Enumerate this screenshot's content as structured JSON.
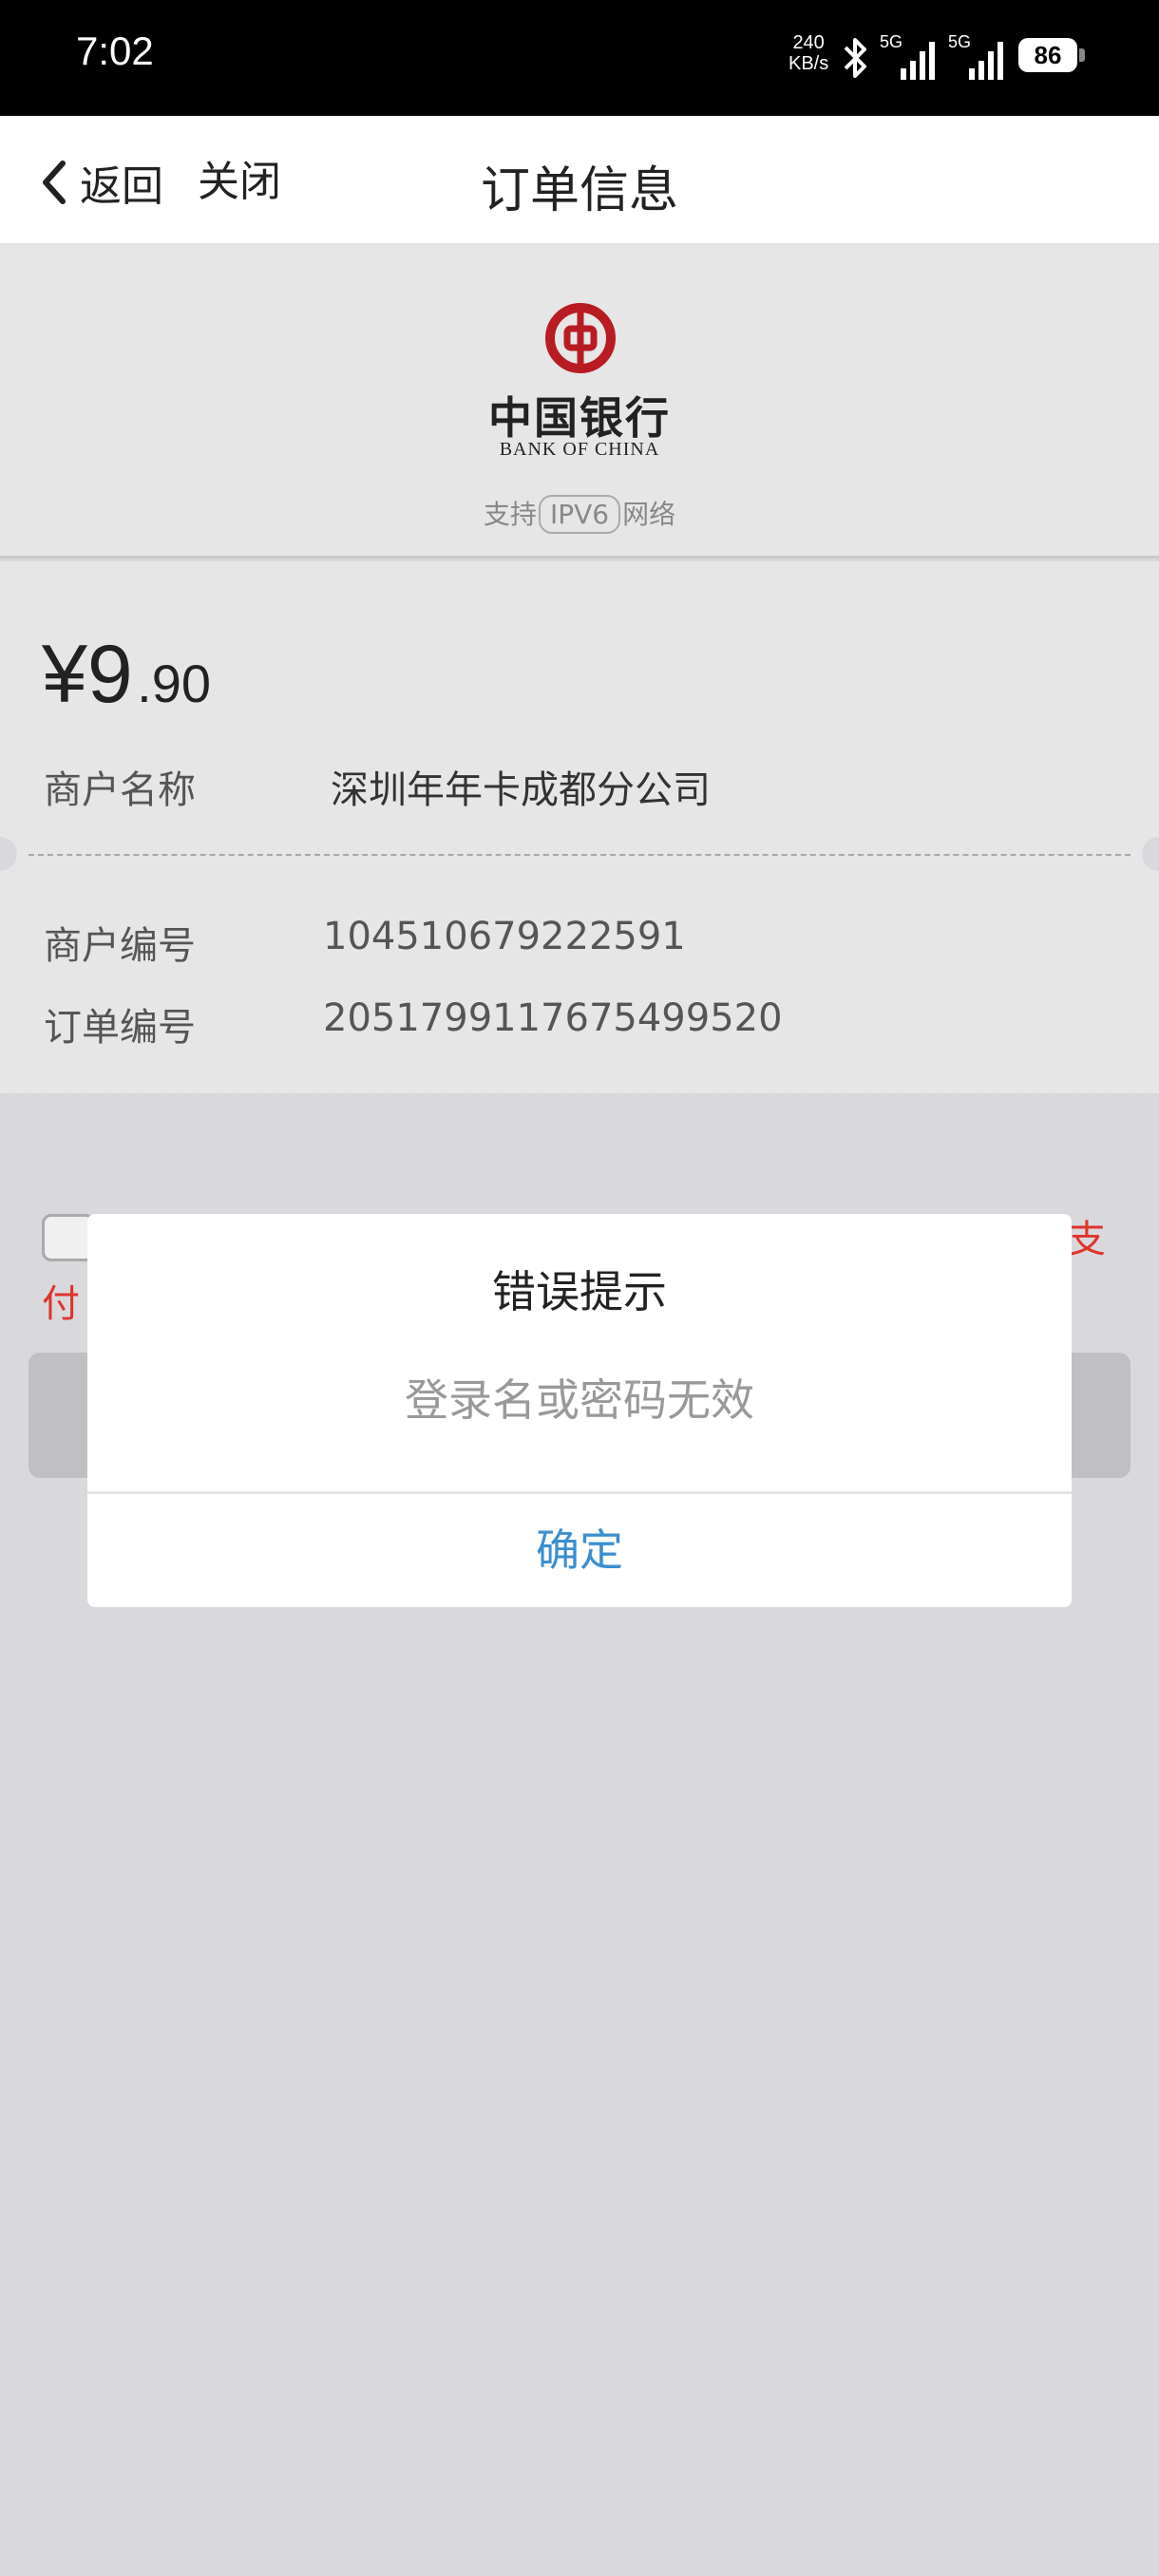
{
  "status_bar": {
    "time": "7:02",
    "network_speed_value": "240",
    "network_speed_unit": "KB/s",
    "sim1_label": "5G",
    "sim2_label": "5G",
    "battery": "86"
  },
  "nav": {
    "back_label": "返回",
    "close_label": "关闭",
    "title": "订单信息"
  },
  "bank": {
    "name_cn": "中国银行",
    "name_en": "BANK OF CHINA",
    "ipv6_prefix": "支持",
    "ipv6_label": "IPV6",
    "ipv6_suffix": "网络",
    "brand_color": "#b81c22"
  },
  "order": {
    "currency": "¥",
    "amount_integer": "9",
    "amount_decimal": ".90",
    "merchant_name_label": "商户名称",
    "merchant_name_value": "深圳年年卡成都分公司",
    "merchant_id_label": "商户编号",
    "merchant_id_value": "104510679222591",
    "order_id_label": "订单编号",
    "order_id_value": "2051799117675499520"
  },
  "behind_dialog": {
    "agree_text_right": "支",
    "agree_text_left": "付"
  },
  "dialog": {
    "title": "错误提示",
    "message": "登录名或密码无效",
    "confirm_label": "确定",
    "confirm_color": "#3a8fd0"
  }
}
